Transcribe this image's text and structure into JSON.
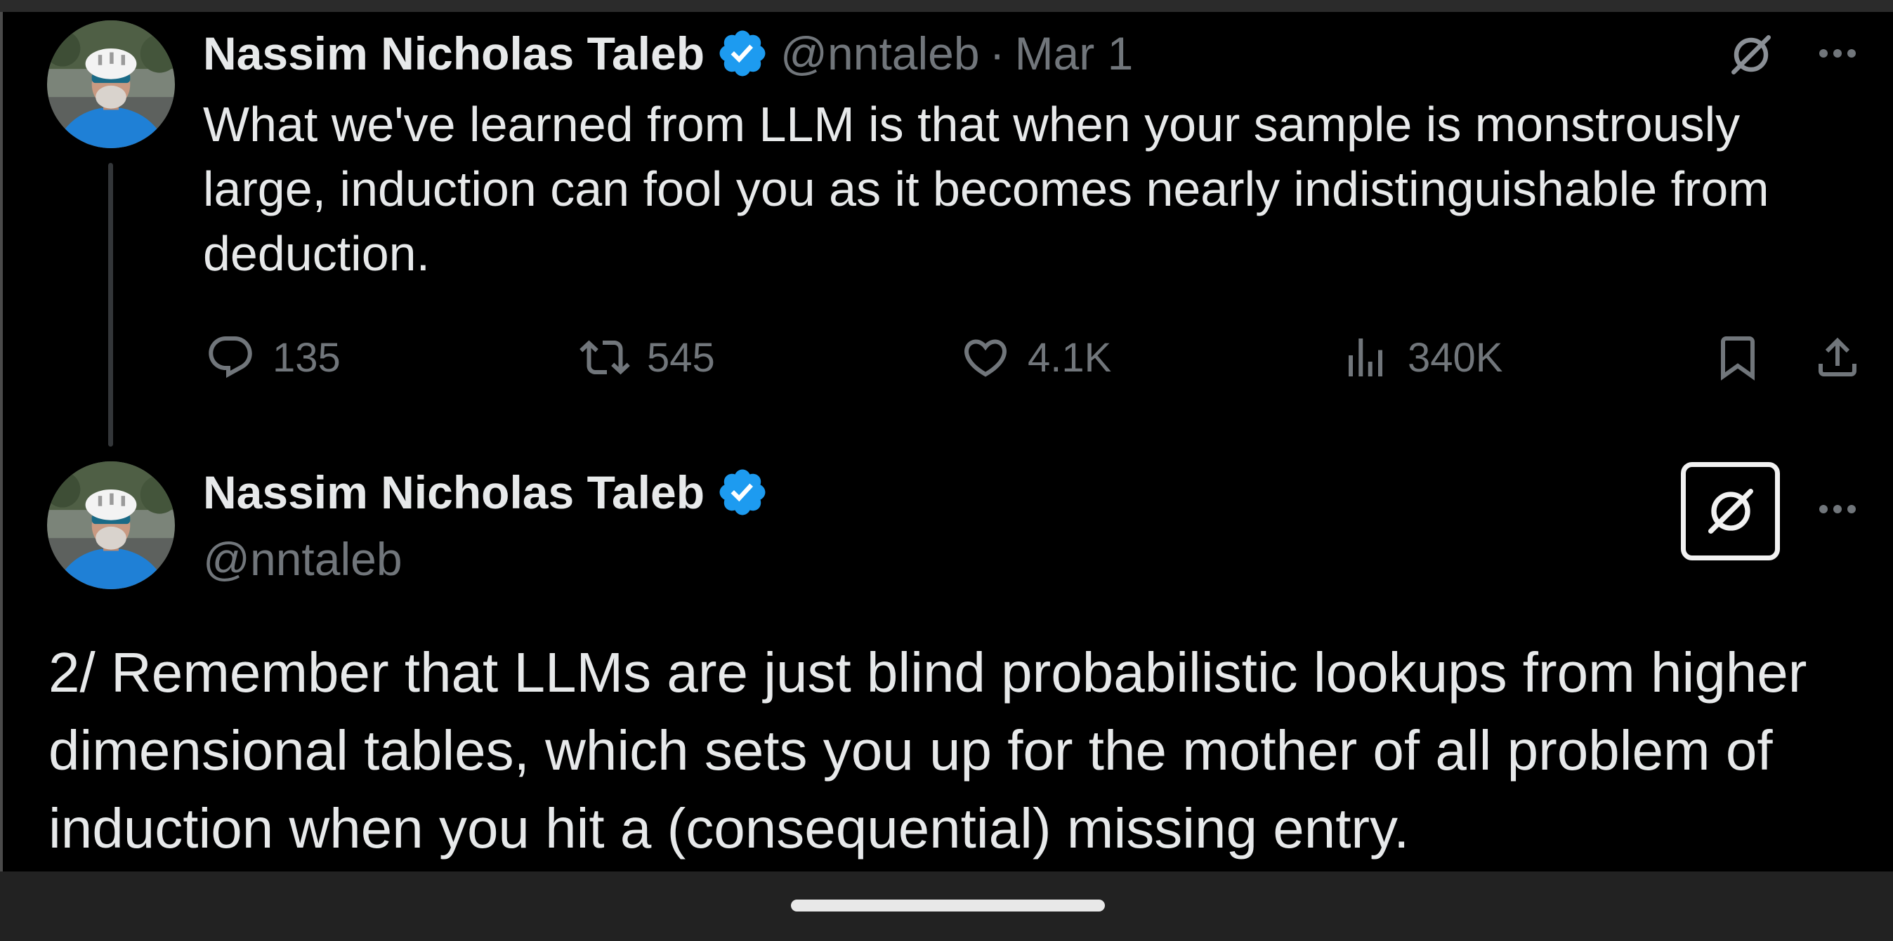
{
  "colors": {
    "background": "#000000",
    "text_primary": "#e7e9ea",
    "text_secondary": "#71767b",
    "verified_badge": "#1d9bf0",
    "thread_line": "#333639",
    "system_bar": "#222222"
  },
  "icons": {
    "verified": "verified-badge-icon",
    "grok": "grok-icon",
    "more": "more-options-icon",
    "reply": "reply-icon",
    "repost": "repost-icon",
    "like": "heart-icon",
    "views": "views-chart-icon",
    "bookmark": "bookmark-icon",
    "share": "share-icon"
  },
  "thread": {
    "tweets": [
      {
        "author": {
          "name": "Nassim Nicholas Taleb",
          "handle": "@nntaleb"
        },
        "separator": "·",
        "date": "Mar 1",
        "text_lines": [
          "What we've learned from LLM is that when your sample is monstrously",
          "large, induction can fool you as it becomes nearly indistinguishable from",
          "deduction."
        ],
        "actions": {
          "replies": "135",
          "reposts": "545",
          "likes": "4.1K",
          "views": "340K"
        }
      },
      {
        "author": {
          "name": "Nassim Nicholas Taleb",
          "handle": "@nntaleb"
        },
        "text_lines": [
          "2/ Remember that LLMs are just blind probabilistic lookups from higher",
          "dimensional tables, which sets you up for the mother of all problem of",
          "induction when you hit a (consequential) missing entry."
        ]
      }
    ]
  }
}
